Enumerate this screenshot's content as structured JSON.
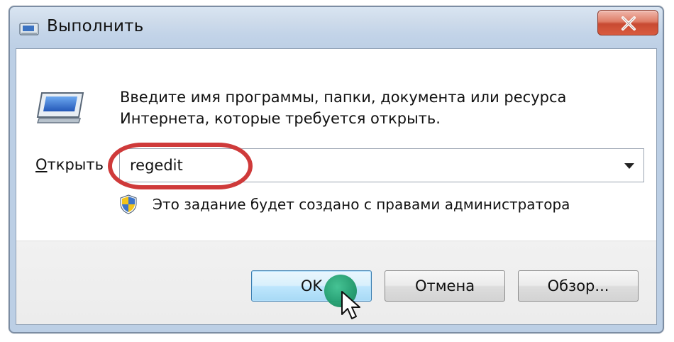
{
  "window": {
    "title": "Выполнить",
    "title_icon": "run-icon",
    "close_icon": "close-icon"
  },
  "body": {
    "run_icon": "run-icon",
    "description": "Введите имя программы, папки, документа или ресурса Интернета, которые требуется открыть.",
    "open_label_accel": "О",
    "open_label_rest": "ткрыть",
    "open_value": "regedit",
    "dropdown_icon": "chevron-down-icon",
    "highlight_color": "#cf3a3a",
    "admin_icon": "uac-shield-icon",
    "admin_note": "Это задание будет создано с правами администратора"
  },
  "buttons": {
    "ok": "OK",
    "cancel": "Отмена",
    "browse": "Обзор..."
  },
  "overlay": {
    "click_marker_color": "#1f9a6b",
    "cursor_icon": "mouse-pointer-icon"
  }
}
